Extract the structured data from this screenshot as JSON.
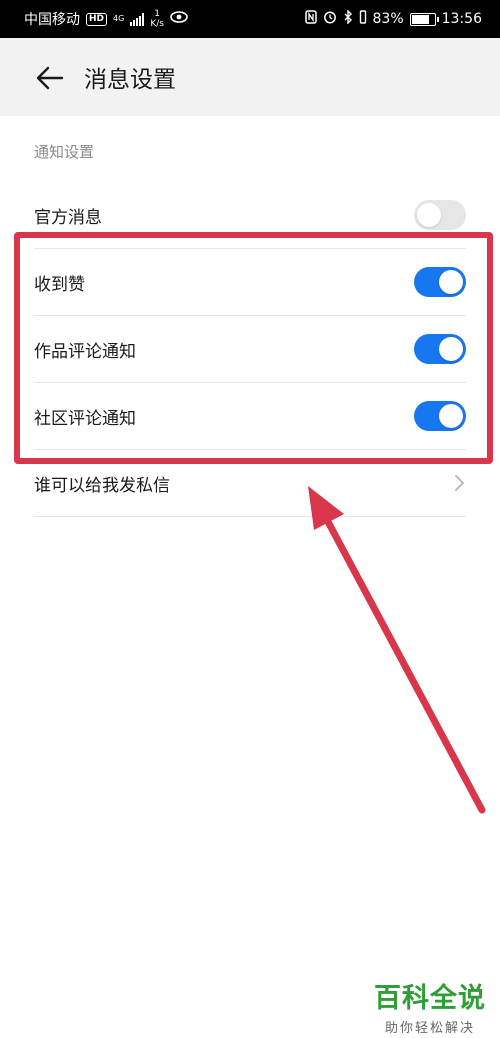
{
  "status_bar": {
    "carrier": "中国移动",
    "hd_badge": "HD",
    "network_type": "4G",
    "speed_value": "1",
    "speed_unit": "K/s",
    "battery_percent": "83%",
    "battery_level": 0.83,
    "time": "13:56",
    "icons": [
      "eye-icon",
      "nfc-icon",
      "alarm-icon",
      "bluetooth-icon",
      "vibrate-icon"
    ]
  },
  "header": {
    "back_icon": "arrow-left-icon",
    "title": "消息设置"
  },
  "section": {
    "label": "通知设置"
  },
  "settings": [
    {
      "label": "官方消息",
      "type": "toggle",
      "enabled": false
    },
    {
      "label": "收到赞",
      "type": "toggle",
      "enabled": true
    },
    {
      "label": "作品评论通知",
      "type": "toggle",
      "enabled": true
    },
    {
      "label": "社区评论通知",
      "type": "toggle",
      "enabled": true
    },
    {
      "label": "谁可以给我发私信",
      "type": "link",
      "icon": "chevron-right-icon"
    }
  ],
  "colors": {
    "toggle_on": "#1677f0",
    "toggle_off": "#e6e6e6",
    "annotation": "#d8364a",
    "watermark": "#2f9e36"
  },
  "watermark": {
    "title": "百科全说",
    "subtitle": "助你轻松解决"
  }
}
